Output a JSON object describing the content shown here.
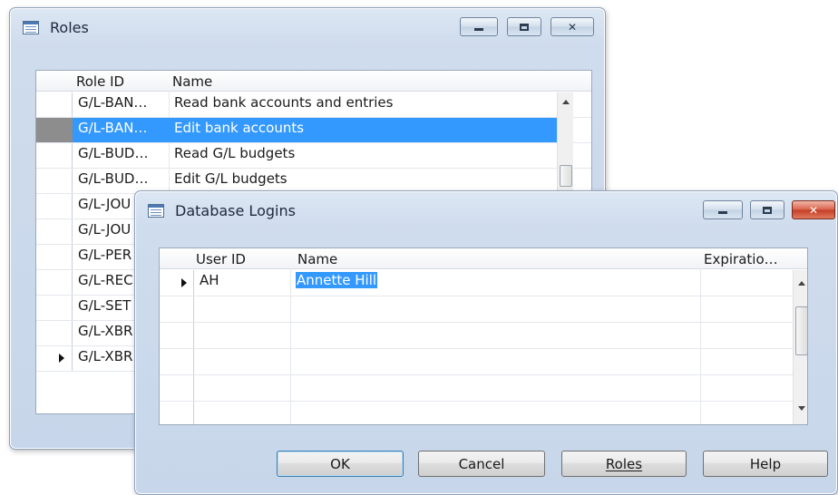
{
  "roles_window": {
    "title": "Roles",
    "columns": {
      "role_id": "Role ID",
      "name": "Name"
    },
    "rows": [
      {
        "role_id": "G/L-BAN…",
        "name": "Read bank accounts and entries"
      },
      {
        "role_id": "G/L-BAN…",
        "name": "Edit bank accounts",
        "selected": true
      },
      {
        "role_id": "G/L-BUD…",
        "name": "Read G/L budgets"
      },
      {
        "role_id": "G/L-BUD…",
        "name": "Edit G/L budgets"
      },
      {
        "role_id": "G/L-JOU",
        "name": ""
      },
      {
        "role_id": "G/L-JOU",
        "name": ""
      },
      {
        "role_id": "G/L-PER",
        "name": ""
      },
      {
        "role_id": "G/L-REC",
        "name": ""
      },
      {
        "role_id": "G/L-SET",
        "name": ""
      },
      {
        "role_id": "G/L-XBR",
        "name": ""
      },
      {
        "role_id": "G/L-XBR",
        "name": ""
      }
    ]
  },
  "logins_window": {
    "title": "Database Logins",
    "columns": {
      "user_id": "User ID",
      "name": "Name",
      "expiration": "Expiratio…"
    },
    "rows": [
      {
        "user_id": "AH",
        "name": "Annette Hill",
        "expiration": ""
      }
    ],
    "buttons": {
      "ok": "OK",
      "cancel": "Cancel",
      "roles": "Roles",
      "help": "Help"
    }
  },
  "icons": {
    "minimize": "minimize-icon",
    "maximize": "maximize-icon",
    "close": "close-icon",
    "form": "form-icon",
    "current-row": "triangle-right-icon"
  }
}
